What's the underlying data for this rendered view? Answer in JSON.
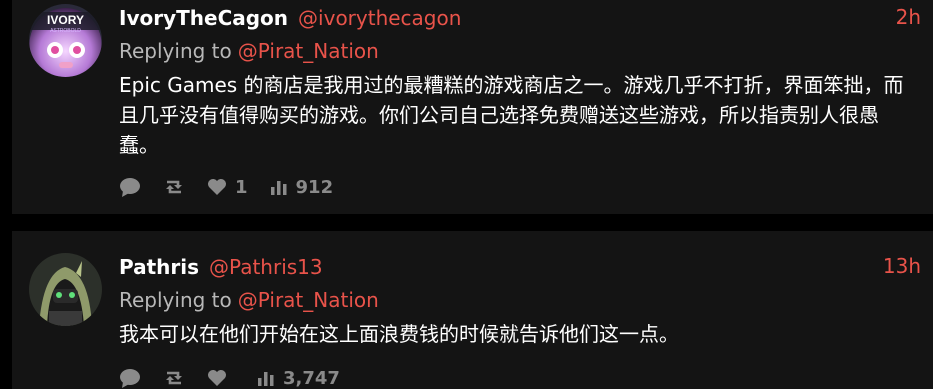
{
  "tweets": [
    {
      "display_name": "IvoryTheCagon",
      "handle": "@ivorythecagon",
      "time": "2h",
      "replying_prefix": "Replying to",
      "replying_to": "@Pirat_Nation",
      "text": "Epic Games 的商店是我用过的最糟糕的游戏商店之一。游戏几乎不打折，界面笨拙，而且几乎没有值得购买的游戏。你们公司自己选择免费赠送这些游戏，所以指责别人很愚蠢。",
      "likes": "1",
      "views": "912",
      "avatar_text_top": "IVORY",
      "avatar_text_bottom": "ASTROBOLD"
    },
    {
      "display_name": "Pathris",
      "handle": "@Pathris13",
      "time": "13h",
      "replying_prefix": "Replying to",
      "replying_to": "@Pirat_Nation",
      "text": "我本可以在他们开始在这上面浪费钱的时候就告诉他们这一点。",
      "likes": "",
      "views": "3,747"
    }
  ],
  "icons": {
    "reply": "comment-icon",
    "retweet": "retweet-icon",
    "like": "heart-icon",
    "views": "bar-chart-icon"
  },
  "colors": {
    "background": "#000000",
    "card": "#141414",
    "accent": "#e8534a",
    "text": "#ffffff",
    "muted": "#8a8a8a"
  }
}
